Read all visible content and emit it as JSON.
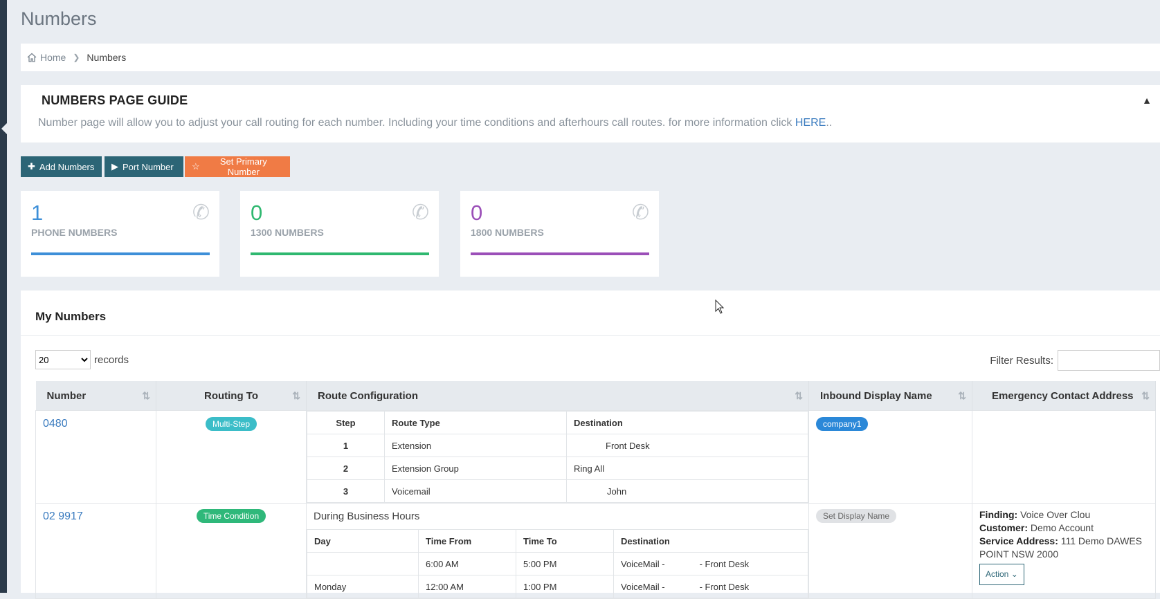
{
  "page": {
    "title": "Numbers"
  },
  "breadcrumb": {
    "home": "Home",
    "current": "Numbers"
  },
  "guide": {
    "title": "NUMBERS PAGE GUIDE",
    "text": "Number page will allow you to adjust your call routing for each number. Including your time conditions and afterhours call routes. for more information click ",
    "link": "HERE",
    "link_suffix": ".."
  },
  "toolbar": {
    "add_label": "Add Numbers",
    "port_label": "Port Number",
    "primary_label": "Set Primary Number"
  },
  "stats": [
    {
      "value": "1",
      "label": "PHONE NUMBERS",
      "color": "#3d8fd8"
    },
    {
      "value": "0",
      "label": "1300 NUMBERS",
      "color": "#2fb870"
    },
    {
      "value": "0",
      "label": "1800 NUMBERS",
      "color": "#9b4fb8"
    }
  ],
  "panel": {
    "title": "My Numbers",
    "page_size": "20",
    "records_label": "records",
    "filter_label": "Filter Results:"
  },
  "table": {
    "headers": {
      "number": "Number",
      "routing": "Routing To",
      "route_config": "Route Configuration",
      "inbound": "Inbound Display Name",
      "emergency": "Emergency Contact Address"
    },
    "row1": {
      "number": "0480",
      "routing": "Multi-Step",
      "inbound": "company1",
      "sub_headers": {
        "step": "Step",
        "type": "Route Type",
        "dest": "Destination"
      },
      "steps": [
        {
          "step": "1",
          "type": "Extension",
          "dest": "Front Desk"
        },
        {
          "step": "2",
          "type": "Extension Group",
          "dest": "Ring All"
        },
        {
          "step": "3",
          "type": "Voicemail",
          "dest": "John"
        }
      ]
    },
    "row2": {
      "number": "02 9917",
      "routing": "Time Condition",
      "inbound": "Set Display Name",
      "section_title": "During Business Hours",
      "sub_headers": {
        "day": "Day",
        "from": "Time From",
        "to": "Time To",
        "dest": "Destination"
      },
      "times": [
        {
          "day": "",
          "from": "6:00 AM",
          "to": "5:00 PM",
          "dest_a": "VoiceMail -",
          "dest_b": "- Front Desk"
        },
        {
          "day": "Monday",
          "from": "12:00 AM",
          "to": "1:00 PM",
          "dest_a": "VoiceMail -",
          "dest_b": "- Front Desk"
        }
      ],
      "emergency": {
        "finding_label": "Finding:",
        "finding_value": "Voice Over Clou",
        "customer_label": "Customer:",
        "customer_value": "Demo Account",
        "address_label": "Service Address:",
        "address_value": "111 Demo DAWES POINT NSW 2000",
        "action_label": "Action"
      }
    }
  }
}
